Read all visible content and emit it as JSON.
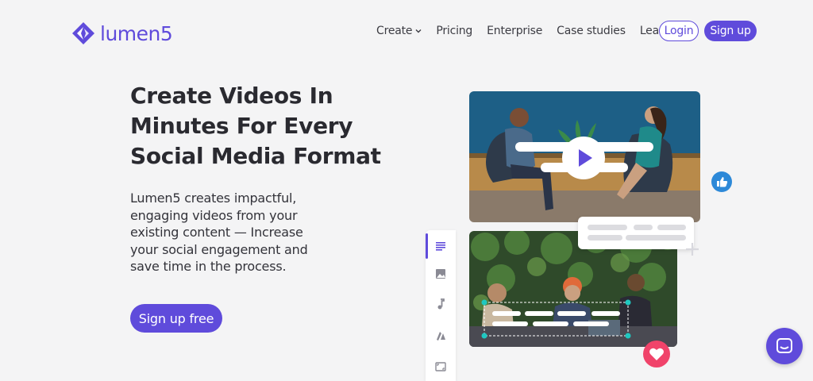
{
  "brand": {
    "name": "lumen5",
    "color": "#5f4bdb"
  },
  "nav": {
    "items": [
      {
        "label": "Create",
        "has_dropdown": true
      },
      {
        "label": "Pricing"
      },
      {
        "label": "Enterprise"
      },
      {
        "label": "Case studies"
      },
      {
        "label": "Learn"
      }
    ],
    "login_label": "Login",
    "signup_label": "Sign up"
  },
  "hero": {
    "title": "Create Videos In Minutes For Every Social Media Format",
    "description": "Lumen5 creates impactful, engaging videos from your existing content — Increase your social engagement and save time in the process.",
    "cta_label": "Sign up free"
  },
  "illustration": {
    "toolbar_icons": [
      "text-icon",
      "image-icon",
      "music-icon",
      "style-icon",
      "aspect-ratio-icon"
    ],
    "active_tool": "text-icon",
    "floating_icons": [
      "thumbs-up-icon",
      "heart-icon",
      "plus-icon",
      "play-icon"
    ]
  },
  "chat": {
    "icon": "chat-icon"
  }
}
